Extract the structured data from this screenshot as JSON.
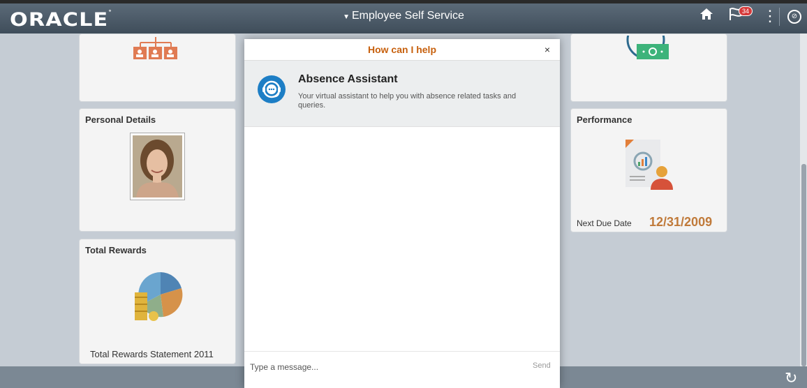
{
  "header": {
    "logo": "ORACLE",
    "title": "Employee Self Service",
    "notification_count": "34"
  },
  "tiles": {
    "personal_details": {
      "title": "Personal Details"
    },
    "performance": {
      "title": "Performance",
      "due_label": "Next Due Date",
      "due_date": "12/31/2009"
    },
    "total_rewards": {
      "title": "Total Rewards",
      "statement": "Total Rewards Statement 2011"
    }
  },
  "dialog": {
    "title": "How can I help",
    "close": "×",
    "assistant_name": "Absence Assistant",
    "assistant_description": "Your virtual assistant to help you with absence related tasks and queries.",
    "message_placeholder": "Type a message...",
    "send_label": "Send"
  },
  "icons": [
    "home-icon",
    "notifications-flag-icon",
    "actions-kebab-icon",
    "navbar-compass-icon",
    "refresh-icon",
    "close-icon",
    "assistant-headset-icon"
  ],
  "colors": {
    "accent_orange": "#c7600d",
    "assistant_blue": "#1d7ec5",
    "header": "#4a5866"
  }
}
